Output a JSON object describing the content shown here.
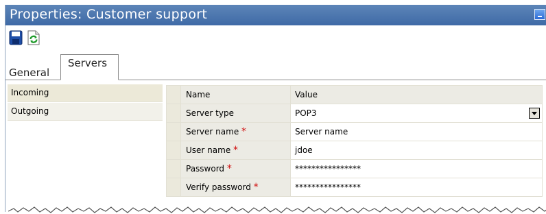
{
  "window": {
    "title": "Properties: Customer support"
  },
  "toolbar": {
    "save_icon": "save-icon",
    "refresh_icon": "refresh-icon"
  },
  "tabs": [
    {
      "label": "General",
      "active": false
    },
    {
      "label": "Servers",
      "active": true
    }
  ],
  "sidebar": {
    "items": [
      {
        "label": "Incoming",
        "selected": true
      },
      {
        "label": "Outgoing",
        "selected": false
      }
    ]
  },
  "grid": {
    "headers": {
      "name": "Name",
      "value": "Value"
    },
    "rows": [
      {
        "name": "Server type",
        "value": "POP3",
        "required": false
      },
      {
        "name": "Server name",
        "value": "Server name",
        "required": true
      },
      {
        "name": "User name",
        "value": "jdoe",
        "required": true
      },
      {
        "name": "Password",
        "value": "****************",
        "required": true
      },
      {
        "name": "Verify password",
        "value": "****************",
        "required": true
      }
    ],
    "required_marker": "*"
  },
  "colors": {
    "titlebar": "#4a74ad",
    "required": "#d01010",
    "header_bg": "#ecebe4"
  }
}
